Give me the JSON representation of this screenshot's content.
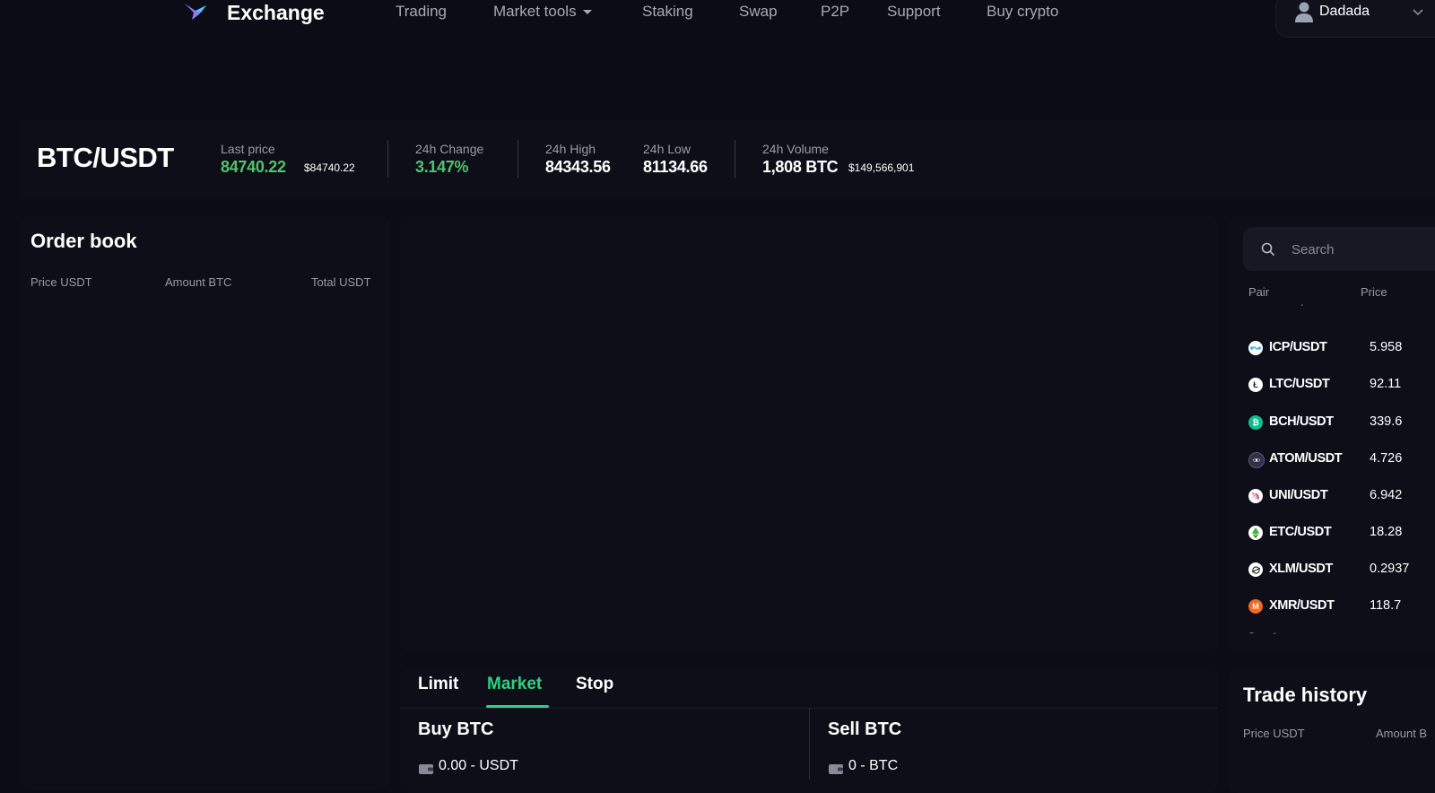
{
  "header": {
    "brand": "Exchange",
    "nav": [
      {
        "label": "Trading"
      },
      {
        "label": "Market tools"
      },
      {
        "label": "Staking"
      },
      {
        "label": "Swap"
      },
      {
        "label": "P2P"
      },
      {
        "label": "Support"
      },
      {
        "label": "Buy crypto"
      }
    ],
    "user": "Dadada"
  },
  "ticker": {
    "pair": "BTC/USDT",
    "last_price_label": "Last price",
    "last_price": "84740.22",
    "last_price_usd": "$84740.22",
    "change_label": "24h Change",
    "change": "3.147%",
    "high_label": "24h High",
    "high": "84343.56",
    "low_label": "24h Low",
    "low": "81134.66",
    "volume_label": "24h Volume",
    "volume": "1,808 BTC",
    "volume_usd": "$149,566,901"
  },
  "order_book": {
    "title": "Order book",
    "columns": [
      "Price USDT",
      "Amount BTC",
      "Total USDT"
    ]
  },
  "markets": {
    "search_placeholder": "Search",
    "columns": [
      "Pair",
      "Price"
    ],
    "pairs": [
      {
        "pair": "ICP/USDT",
        "price": "5.958",
        "icon": "icp-icon",
        "color": "#ffffff"
      },
      {
        "pair": "LTC/USDT",
        "price": "92.11",
        "icon": "ltc-icon",
        "color": "#ffffff"
      },
      {
        "pair": "BCH/USDT",
        "price": "339.6",
        "icon": "bch-icon",
        "color": "#0ac18e"
      },
      {
        "pair": "ATOM/USDT",
        "price": "4.726",
        "icon": "atom-icon",
        "color": "#2e3148"
      },
      {
        "pair": "UNI/USDT",
        "price": "6.942",
        "icon": "uni-icon",
        "color": "#ff007a"
      },
      {
        "pair": "ETC/USDT",
        "price": "18.28",
        "icon": "etc-icon",
        "color": "#ffffff"
      },
      {
        "pair": "XLM/USDT",
        "price": "0.2937",
        "icon": "xlm-icon",
        "color": "#ffffff"
      },
      {
        "pair": "XMR/USDT",
        "price": "118.7",
        "icon": "xmr-icon",
        "color": "#f26822"
      }
    ]
  },
  "trade": {
    "tabs": [
      "Limit",
      "Market",
      "Stop"
    ],
    "active_tab": "Market",
    "buy_title": "Buy BTC",
    "buy_balance": "0.00 - USDT",
    "sell_title": "Sell BTC",
    "sell_balance": "0 - BTC"
  },
  "trade_history": {
    "title": "Trade history",
    "columns": [
      "Price USDT",
      "Amount B"
    ]
  },
  "colors": {
    "background": "#0c0c16",
    "panel": "#0e0e19",
    "positive": "#4ec46a",
    "accent": "#2fd07e"
  }
}
